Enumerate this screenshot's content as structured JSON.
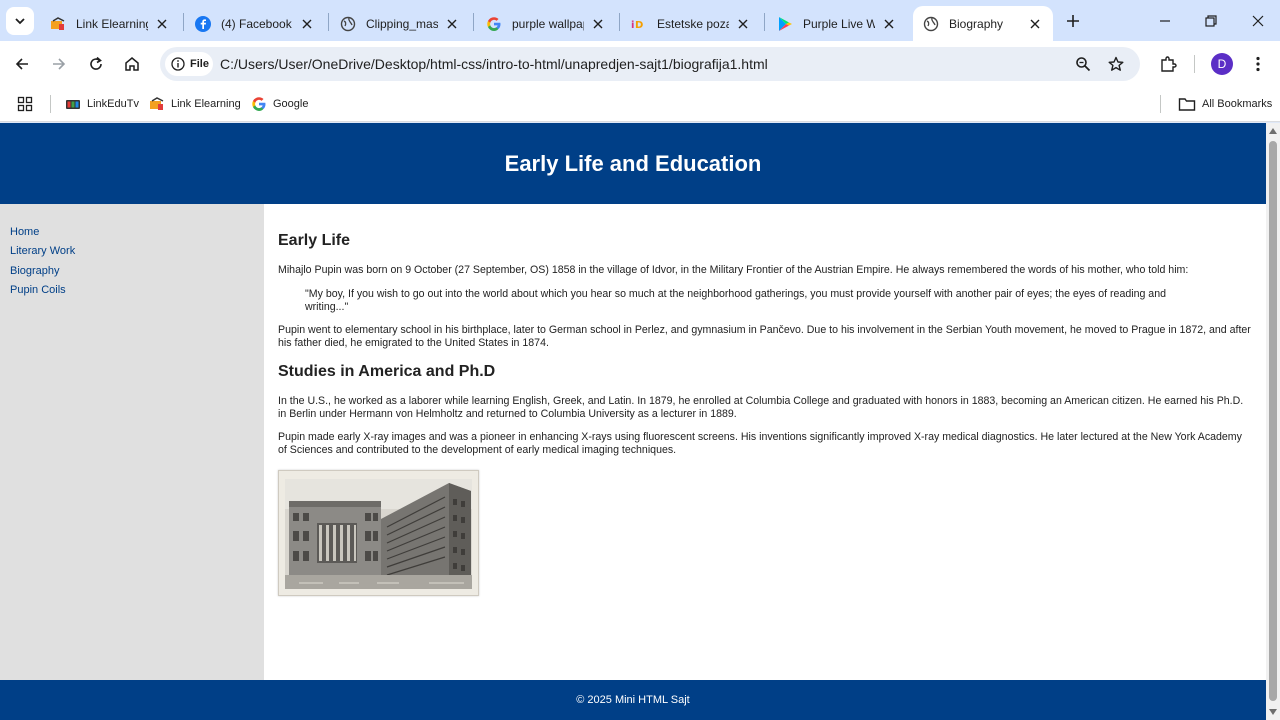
{
  "tabs": [
    {
      "title": "Link Elearning",
      "icon": "link-elearning-icon"
    },
    {
      "title": "(4) Facebook",
      "icon": "facebook-icon"
    },
    {
      "title": "Clipping_mask",
      "icon": "globe-icon"
    },
    {
      "title": "purple wallpaper",
      "icon": "google-icon"
    },
    {
      "title": "Estetske pozadine",
      "icon": "estetske-icon"
    },
    {
      "title": "Purple Live Wallp",
      "icon": "play-store-icon"
    },
    {
      "title": "Biography",
      "icon": "globe-icon",
      "active": true
    }
  ],
  "toolbar": {
    "chip_label": "File",
    "url": "C:/Users/User/OneDrive/Desktop/html-css/intro-to-html/unapredjen-sajt1/biografija1.html",
    "avatar_letter": "D"
  },
  "bookmarks": {
    "items": [
      {
        "label": "LinkEduTv"
      },
      {
        "label": "Link Elearning"
      },
      {
        "label": "Google"
      }
    ],
    "all_label": "All Bookmarks"
  },
  "page": {
    "header_title": "Early Life and Education",
    "nav": [
      "Home",
      "Literary Work",
      "Biography",
      "Pupin Coils"
    ],
    "section1_heading": "Early Life",
    "section1_p1": "Mihajlo Pupin was born on 9 October (27 September, OS) 1858 in the village of Idvor, in the Military Frontier of the Austrian Empire. He always remembered the words of his mother, who told him:",
    "quote": "\"My boy, If you wish to go out into the world about which you hear so much at the neighborhood gatherings, you must provide yourself with another pair of eyes; the eyes of reading and writing...\"",
    "section1_p2": "Pupin went to elementary school in his birthplace, later to German school in Perlez, and gymnasium in Pančevo. Due to his involvement in the Serbian Youth movement, he moved to Prague in 1872, and after his father died, he emigrated to the United States in 1874.",
    "section2_heading": "Studies in America and Ph.D",
    "section2_p1": "In the U.S., he worked as a laborer while learning English, Greek, and Latin. In 1879, he enrolled at Columbia College and graduated with honors in 1883, becoming an American citizen. He earned his Ph.D. in Berlin under Hermann von Helmholtz and returned to Columbia University as a lecturer in 1889.",
    "section2_p2": "Pupin made early X-ray images and was a pioneer in enhancing X-rays using fluorescent screens. His inventions significantly improved X-ray medical diagnostics. He later lectured at the New York Academy of Sciences and contributed to the development of early medical imaging techniques.",
    "footer": "© 2025 Mini HTML Sajt"
  },
  "colors": {
    "header_bg": "#003f87",
    "sidebar_bg": "#e0e0e0",
    "link": "#003f87",
    "tabstrip_bg": "#d3e3fd"
  }
}
